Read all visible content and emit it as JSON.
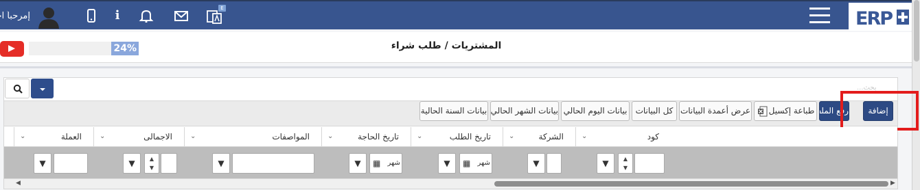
{
  "header": {
    "greeting": "إمرحباً احمد",
    "lang_badge": "E",
    "icons": [
      "avatar-icon",
      "mobile-icon",
      "info-icon",
      "bell-icon",
      "mail-icon",
      "language-icon",
      "menu-icon"
    ],
    "logo_text": "ERP"
  },
  "titlebar": {
    "title": "المشتريات / طلب شراء",
    "progress": "24%",
    "progress_value": 0.24
  },
  "search": {
    "faint_text": "بحث..."
  },
  "toolbar": {
    "add": "إضافة",
    "upload": "رفع الملف",
    "print_excel": "طباعة إكسيل",
    "show_columns": "عرض أعمدة البيانات",
    "all_data": "كل البيانات",
    "today_data": "بيانات اليوم الحالي",
    "month_data": "بيانات الشهر الحالي",
    "year_data": "بيانات السنة الحالية"
  },
  "table": {
    "columns": [
      "كود",
      "الشركة",
      "تاريخ الطلب",
      "تاريخ الحاجة",
      "المواصفات",
      "الاجمالى",
      "العملة"
    ],
    "month_label": "شهر"
  },
  "colors": {
    "topbar": "#38558f",
    "primary_button": "#2d4a84",
    "highlight_box": "#e31c1c",
    "progress_fill": "#8aa7dc"
  }
}
